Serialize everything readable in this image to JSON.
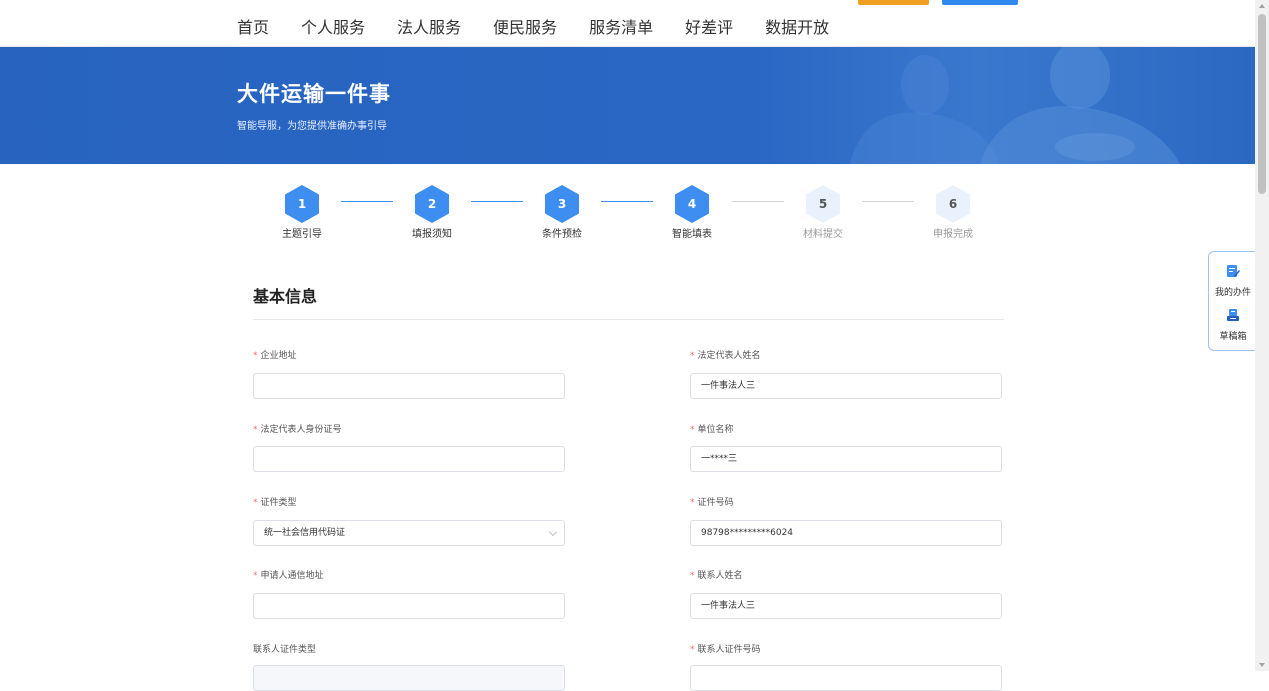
{
  "nav": {
    "items": [
      "首页",
      "个人服务",
      "法人服务",
      "便民服务",
      "服务清单",
      "好差评",
      "数据开放"
    ]
  },
  "banner": {
    "title": "大件运输一件事",
    "subtitle": "智能导服，为您提供准确办事引导"
  },
  "steps": [
    {
      "num": "1",
      "label": "主题引导",
      "state": "done"
    },
    {
      "num": "2",
      "label": "填报须知",
      "state": "done"
    },
    {
      "num": "3",
      "label": "条件预检",
      "state": "done"
    },
    {
      "num": "4",
      "label": "智能填表",
      "state": "done"
    },
    {
      "num": "5",
      "label": "材料提交",
      "state": "todo"
    },
    {
      "num": "6",
      "label": "申报完成",
      "state": "todo"
    }
  ],
  "float_panel": {
    "my_items": "我的办件",
    "drafts": "草稿箱"
  },
  "form": {
    "section_title": "基本信息",
    "required_mark": "*",
    "fields": [
      {
        "label": "企业地址",
        "required": true,
        "value": ""
      },
      {
        "label": "法定代表人姓名",
        "required": true,
        "value": "一件事法人三"
      },
      {
        "label": "法定代表人身份证号",
        "required": true,
        "value": ""
      },
      {
        "label": "单位名称",
        "required": true,
        "value": "一****三"
      },
      {
        "label": "证件类型",
        "required": true,
        "value": "统一社会信用代码证"
      },
      {
        "label": "证件号码",
        "required": true,
        "value": "98798*********6024"
      },
      {
        "label": "申请人通信地址",
        "required": true,
        "value": ""
      },
      {
        "label": "联系人姓名",
        "required": true,
        "value": "一件事法人三"
      },
      {
        "label": "联系人证件类型",
        "required": false,
        "value": ""
      },
      {
        "label": "联系人证件号码",
        "required": true,
        "value": ""
      }
    ]
  },
  "colors": {
    "primary": "#3d8ef0",
    "banner": "#2763bf",
    "required": "#f56c6c"
  }
}
